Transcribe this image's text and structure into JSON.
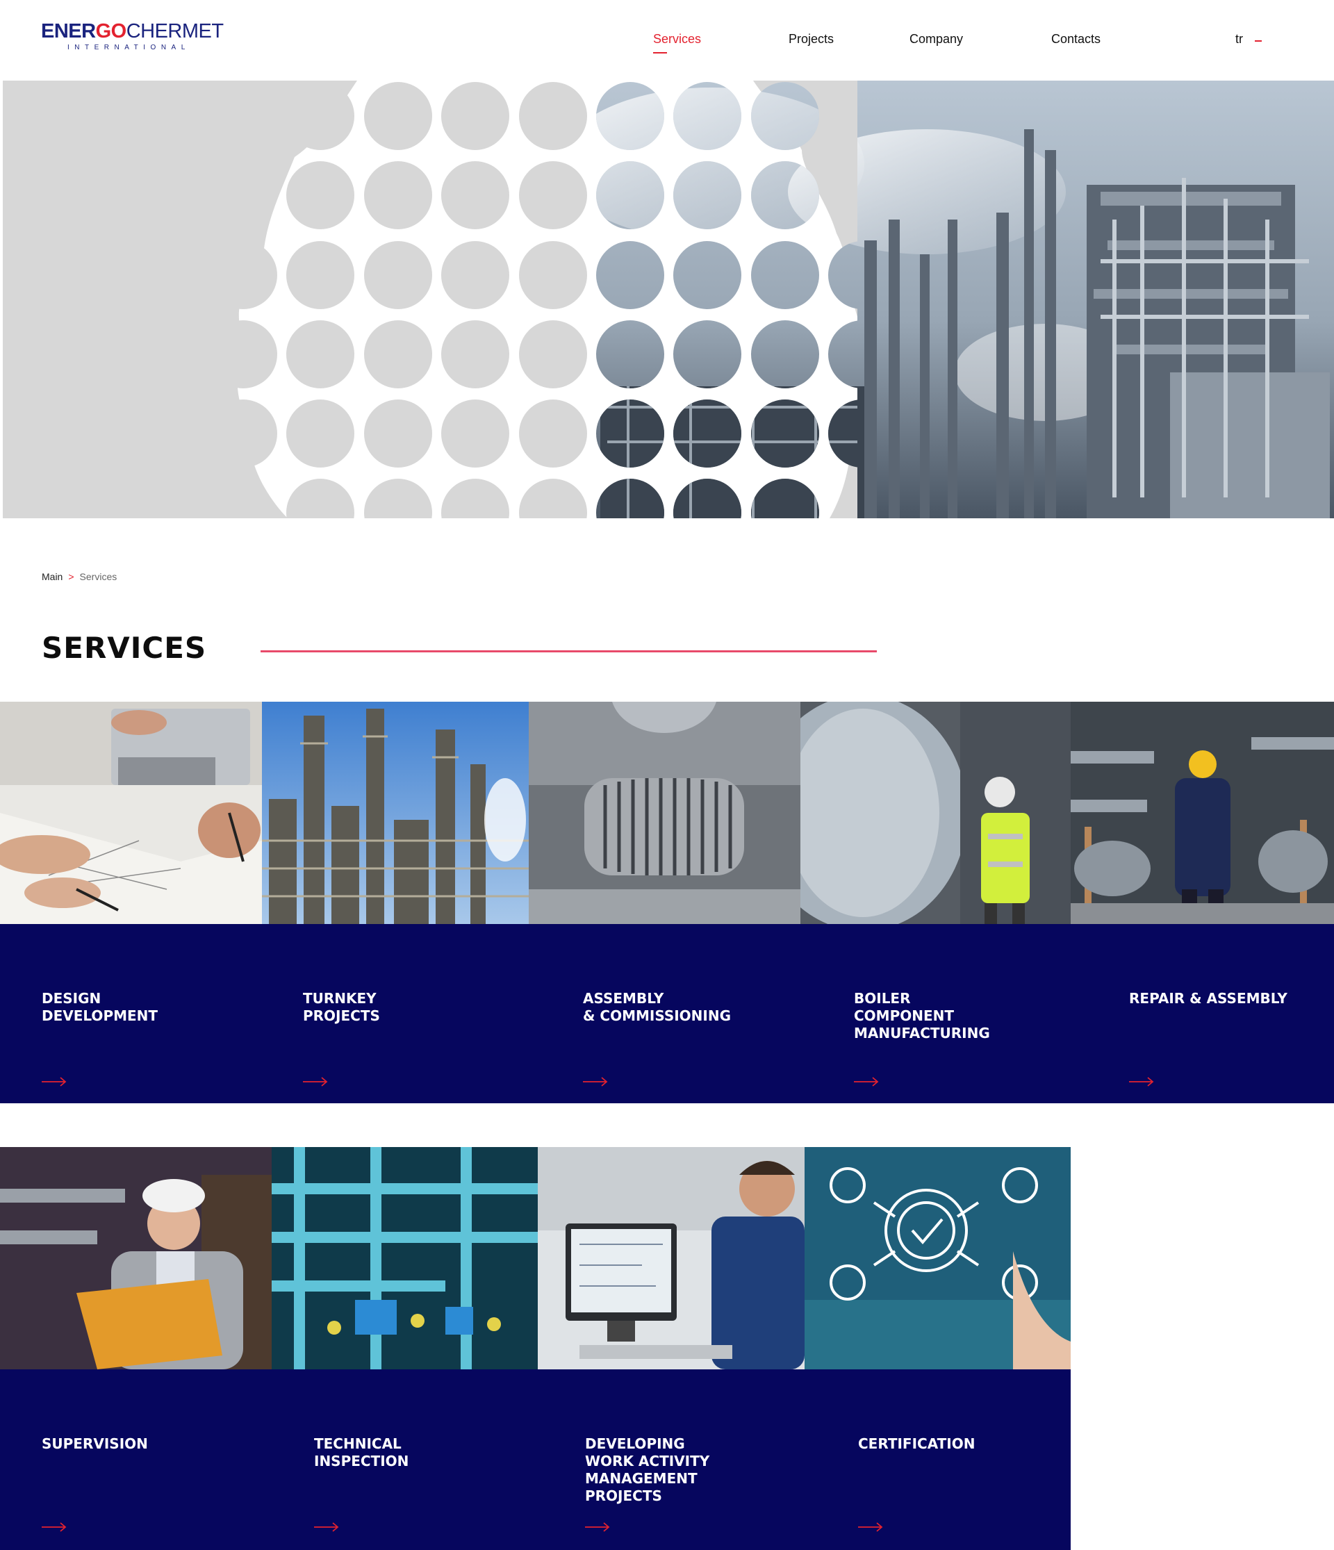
{
  "header": {
    "logo": {
      "part1": "ENER",
      "part2": "GO",
      "part3": "CHERMET",
      "sub": "INTERNATIONAL"
    },
    "nav": [
      {
        "label": "Services",
        "active": true
      },
      {
        "label": "Projects",
        "active": false
      },
      {
        "label": "Company",
        "active": false
      },
      {
        "label": "Contacts",
        "active": false
      }
    ],
    "lang": "tr"
  },
  "hero": {
    "image": "industrial-plant-photo-with-circle-pattern"
  },
  "breadcrumb": {
    "main": "Main",
    "separator": ">",
    "current": "Services"
  },
  "section": {
    "title": "SERVICES"
  },
  "services": [
    {
      "label": "DESIGN\nDEVELOPMENT",
      "image": "design-drawing-photo"
    },
    {
      "label": "TURNKEY\nPROJECTS",
      "image": "refinery-towers-photo"
    },
    {
      "label": "ASSEMBLY\n& COMMISSIONING",
      "image": "turbine-rotor-photo"
    },
    {
      "label": "BOILER\nCOMPONENT\nMANUFACTURING",
      "image": "worker-boiler-photo"
    },
    {
      "label": "REPAIR & ASSEMBLY",
      "image": "worker-pipes-photo"
    },
    {
      "label": "SUPERVISION",
      "image": "engineer-folder-photo"
    },
    {
      "label": "TECHNICAL\nINSPECTION",
      "image": "blue-pipes-photo"
    },
    {
      "label": "DEVELOPING\nWORK ACTIVITY\nMANAGEMENT\nPROJECTS",
      "image": "engineer-computer-photo"
    },
    {
      "label": "CERTIFICATION",
      "image": "certification-gear-photo"
    }
  ],
  "colors": {
    "navy": "#06065e",
    "accent": "#e3222f",
    "brand": "#1a237e"
  }
}
